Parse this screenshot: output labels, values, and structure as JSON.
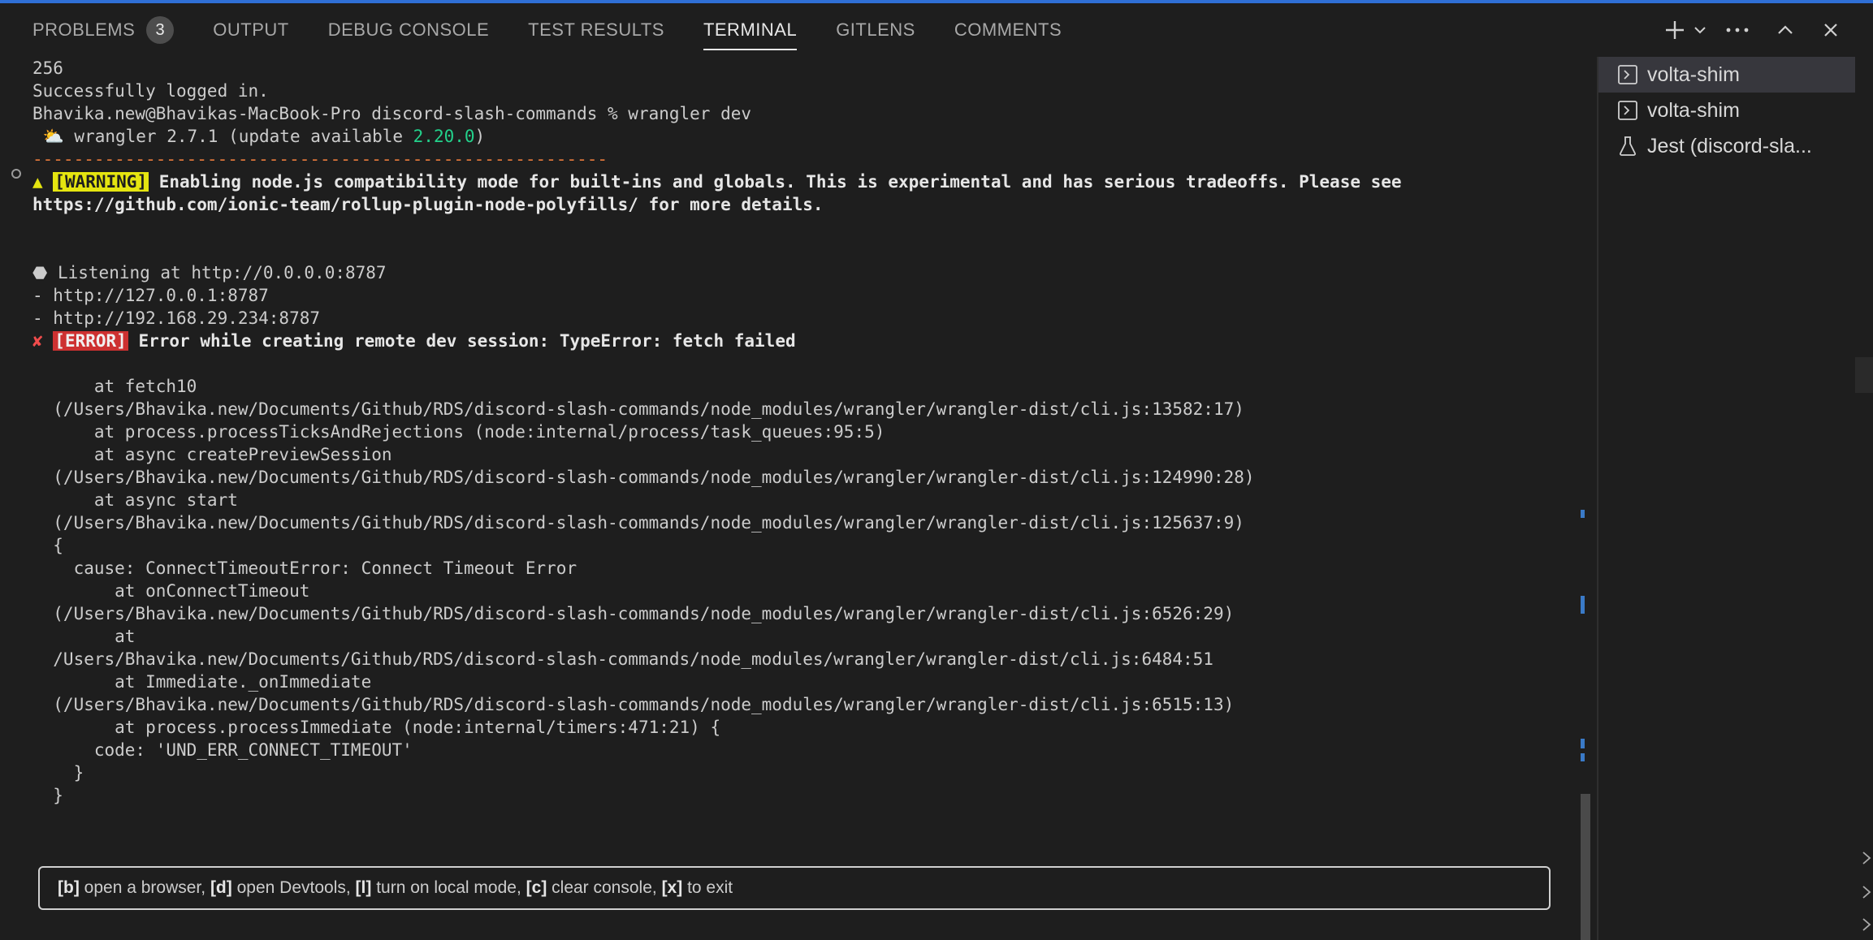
{
  "tabs": [
    {
      "label": "PROBLEMS",
      "badge": "3"
    },
    {
      "label": "OUTPUT"
    },
    {
      "label": "DEBUG CONSOLE"
    },
    {
      "label": "TEST RESULTS"
    },
    {
      "label": "TERMINAL",
      "active": true
    },
    {
      "label": "GITLENS"
    },
    {
      "label": "COMMENTS"
    }
  ],
  "actions": {
    "new_terminal": "new-terminal-plus-icon",
    "dropdown": "chevron-down-icon",
    "more": "more-actions-icon",
    "maximize": "chevron-up-icon",
    "close": "close-icon"
  },
  "terminal": {
    "line_256": "256",
    "login": "Successfully logged in.",
    "prompt": "Bhavika.new@Bhavikas-MacBook-Pro discord-slash-commands % wrangler dev",
    "wrangler_prefix": " ⛅ wrangler 2.7.1 (update available ",
    "wrangler_version": "2.20.0",
    "wrangler_suffix": ")",
    "dashes": "--------------------------------------------------------",
    "warning_icon": "▲ ",
    "warning_tag": "[WARNING]",
    "warning_text": " Enabling node.js compatibility mode for built-ins and globals. This is experimental and has serious tradeoffs. Please see",
    "warning_text2": "https://github.com/ionic-team/rollup-plugin-node-polyfills/ for more details.",
    "listening": "⬣ Listening at http://0.0.0.0:8787",
    "local1": "- http://127.0.0.1:8787",
    "local2": "- http://192.168.29.234:8787",
    "error_icon": "✘ ",
    "error_tag": "[ERROR]",
    "error_text": " Error while creating remote dev session: TypeError: fetch failed",
    "stack": [
      "      at fetch10",
      "  (/Users/Bhavika.new/Documents/Github/RDS/discord-slash-commands/node_modules/wrangler/wrangler-dist/cli.js:13582:17)",
      "      at process.processTicksAndRejections (node:internal/process/task_queues:95:5)",
      "      at async createPreviewSession",
      "  (/Users/Bhavika.new/Documents/Github/RDS/discord-slash-commands/node_modules/wrangler/wrangler-dist/cli.js:124990:28)",
      "      at async start",
      "  (/Users/Bhavika.new/Documents/Github/RDS/discord-slash-commands/node_modules/wrangler/wrangler-dist/cli.js:125637:9)",
      "  {",
      "    cause: ConnectTimeoutError: Connect Timeout Error",
      "        at onConnectTimeout",
      "  (/Users/Bhavika.new/Documents/Github/RDS/discord-slash-commands/node_modules/wrangler/wrangler-dist/cli.js:6526:29)",
      "        at",
      "  /Users/Bhavika.new/Documents/Github/RDS/discord-slash-commands/node_modules/wrangler/wrangler-dist/cli.js:6484:51",
      "        at Immediate._onImmediate",
      "  (/Users/Bhavika.new/Documents/Github/RDS/discord-slash-commands/node_modules/wrangler/wrangler-dist/cli.js:6515:13)",
      "        at process.processImmediate (node:internal/timers:471:21) {",
      "      code: 'UND_ERR_CONNECT_TIMEOUT'",
      "    }",
      "  }"
    ]
  },
  "hint": [
    {
      "key": "[b]",
      "text": " open a browser, "
    },
    {
      "key": "[d]",
      "text": " open Devtools, "
    },
    {
      "key": "[l]",
      "text": " turn on local mode, "
    },
    {
      "key": "[c]",
      "text": " clear console, "
    },
    {
      "key": "[x]",
      "text": " to exit"
    }
  ],
  "terminal_list": [
    {
      "label": "volta-shim",
      "icon": "terminal-icon",
      "selected": true
    },
    {
      "label": "volta-shim",
      "icon": "terminal-icon"
    },
    {
      "label": "Jest (discord-sla...",
      "icon": "beaker-icon"
    }
  ],
  "colors": {
    "accent": "#2f6fd6",
    "warning_bg": "#e5e510",
    "error_bg": "#cd3131",
    "version_green": "#23d18b",
    "dashes_orange": "#e0773b"
  }
}
